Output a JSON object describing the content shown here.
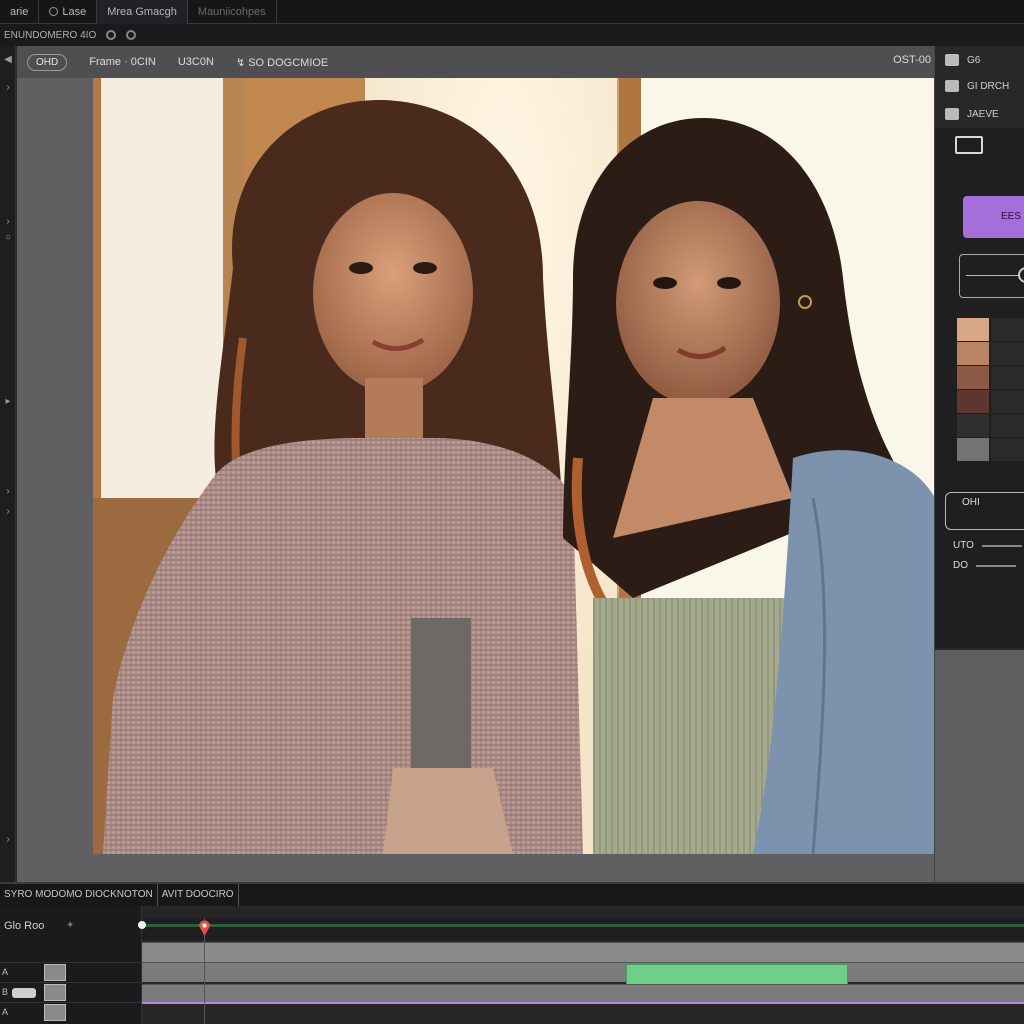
{
  "tabs": [
    {
      "label": "arie"
    },
    {
      "label": "Lase"
    },
    {
      "label": "Mrea Gmacgh"
    },
    {
      "label": "Mauniicohpes"
    }
  ],
  "project": {
    "title": "ENUNDOMERO 4IO"
  },
  "viewer": {
    "pill": "OHD",
    "items": [
      "Frame · 0CIN",
      "U3C0N",
      "↯  SO DOGCMIOE"
    ],
    "right_label": "OST-00"
  },
  "right_panel": {
    "row1": "G6",
    "row2": "GI DRCH",
    "row3": "JAEVE",
    "purple_label": "EES",
    "field_label": "OHI",
    "range1_label": "UTO",
    "range2_label": "DO",
    "swatch_colors": [
      "#d8a788",
      "#b98465",
      "#8c5a45",
      "#5f3530",
      "#2f2f31",
      "#747476"
    ]
  },
  "timeline": {
    "title": "SYRO MODOMO DIOCKNOTON",
    "subtitle": "AVIT DOOCIRO",
    "label": "Glo Roo",
    "tracks": [
      {
        "letter": "A"
      },
      {
        "letter": "B"
      },
      {
        "letter": "A"
      }
    ],
    "accent_green": "#6fcf86",
    "accent_purple": "#b48ad8",
    "playhead_color": "#e0524a"
  }
}
